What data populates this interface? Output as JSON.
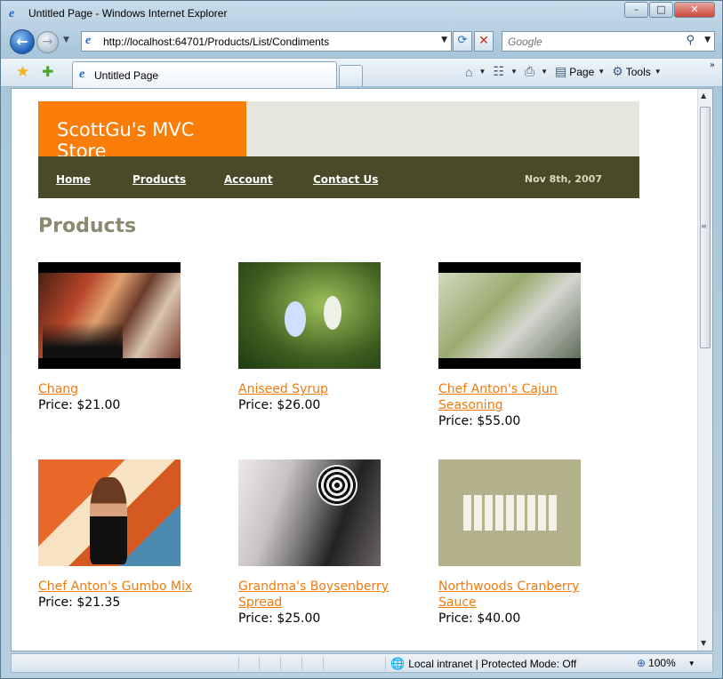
{
  "window": {
    "title": "Untitled Page - Windows Internet Explorer",
    "controls": {
      "minimize": "–",
      "maximize": "□",
      "close": "✕"
    }
  },
  "navigation": {
    "back": "←",
    "forward": "→",
    "address": "http://localhost:64701/Products/List/Condiments",
    "search_placeholder": "Google"
  },
  "tabs": {
    "active_label": "Untitled Page"
  },
  "commands": {
    "page": "Page",
    "tools": "Tools"
  },
  "site": {
    "store_title": "ScottGu's MVC Store",
    "menu": [
      "Home",
      "Products",
      "Account",
      "Contact Us"
    ],
    "date": "Nov 8th, 2007",
    "heading": "Products"
  },
  "products": [
    {
      "name": "Chang ",
      "price": "Price: $21.00"
    },
    {
      "name": "Aniseed Syrup ",
      "price": "Price: $26.00"
    },
    {
      "name": "Chef Anton's Cajun Seasoning ",
      "price": "Price: $55.00"
    },
    {
      "name": "Chef Anton's Gumbo Mix ",
      "price": "Price: $21.35"
    },
    {
      "name": "Grandma's Boysenberry Spread ",
      "price": "Price: $25.00"
    },
    {
      "name": "Northwoods Cranberry Sauce ",
      "price": "Price: $40.00"
    }
  ],
  "status": {
    "zone": "Local intranet | Protected Mode: Off",
    "zoom": "100%"
  },
  "colors": {
    "accent_orange": "#fb7d09",
    "menu_bar": "#494a27",
    "header_band": "#e7e6de",
    "heading": "#8b8a70",
    "link": "#f17a0e"
  }
}
